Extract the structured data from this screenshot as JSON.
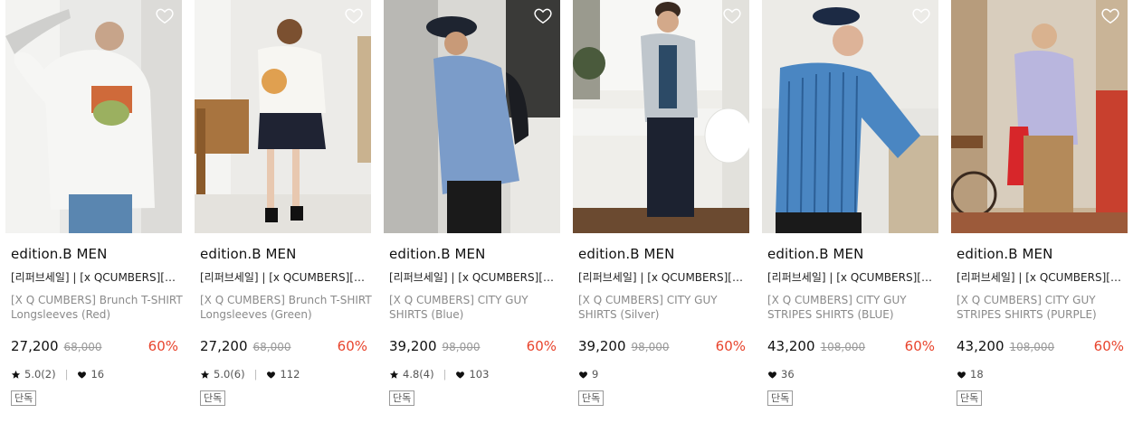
{
  "products": [
    {
      "brand": "edition.B MEN",
      "promo": "[리퍼브세일] | [x QCUMBERS][2...",
      "name": "[X Q CUMBERS] Brunch T-SHIRT Longsleeves (Red)",
      "price": "27,200",
      "original": "68,000",
      "discount": "60%",
      "rating": "5.0(2)",
      "likes": "16",
      "badge": "단독"
    },
    {
      "brand": "edition.B MEN",
      "promo": "[리퍼브세일] | [x QCUMBERS][2...",
      "name": "[X Q CUMBERS] Brunch T-SHIRT Longsleeves (Green)",
      "price": "27,200",
      "original": "68,000",
      "discount": "60%",
      "rating": "5.0(6)",
      "likes": "112",
      "badge": "단독"
    },
    {
      "brand": "edition.B MEN",
      "promo": "[리퍼브세일] | [x QCUMBERS][2...",
      "name": "[X Q CUMBERS] CITY GUY SHIRTS (Blue)",
      "price": "39,200",
      "original": "98,000",
      "discount": "60%",
      "rating": "4.8(4)",
      "likes": "103",
      "badge": "단독"
    },
    {
      "brand": "edition.B MEN",
      "promo": "[리퍼브세일] | [x QCUMBERS][2...",
      "name": "[X Q CUMBERS] CITY GUY SHIRTS (Silver)",
      "price": "39,200",
      "original": "98,000",
      "discount": "60%",
      "rating": "",
      "likes": "9",
      "badge": "단독"
    },
    {
      "brand": "edition.B MEN",
      "promo": "[리퍼브세일] | [x QCUMBERS][2...",
      "name": "[X Q CUMBERS] CITY GUY STRIPES SHIRTS (BLUE)",
      "price": "43,200",
      "original": "108,000",
      "discount": "60%",
      "rating": "",
      "likes": "36",
      "badge": "단독"
    },
    {
      "brand": "edition.B MEN",
      "promo": "[리퍼브세일] | [x QCUMBERS][2...",
      "name": "[X Q CUMBERS] CITY GUY STRIPES SHIRTS (PURPLE)",
      "price": "43,200",
      "original": "108,000",
      "discount": "60%",
      "rating": "",
      "likes": "18",
      "badge": "단독"
    }
  ],
  "icons": {
    "wishlist": "heart-outline-icon",
    "rating": "star-icon",
    "likes": "heart-filled-icon"
  },
  "colors": {
    "discount": "#e8442d",
    "muted": "#8a8a8a",
    "text": "#111111"
  }
}
